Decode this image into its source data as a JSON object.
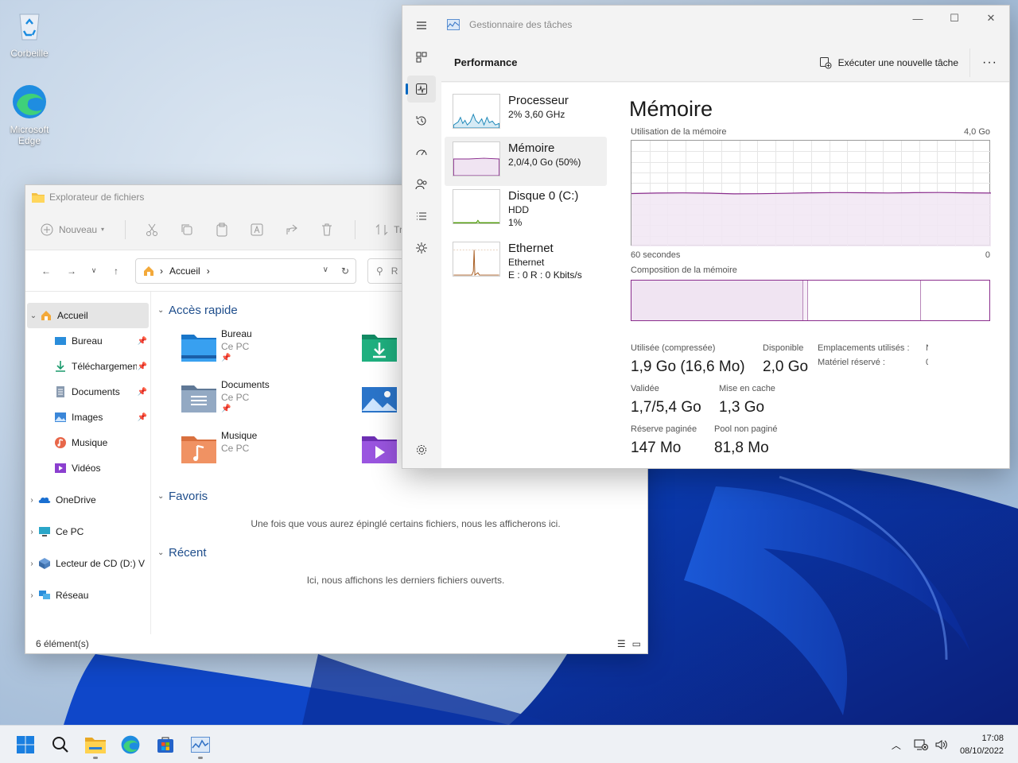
{
  "desktop": {
    "icons": [
      {
        "label": "Corbeille"
      },
      {
        "label": "Microsoft Edge"
      }
    ]
  },
  "explorer": {
    "title": "Explorateur de fichiers",
    "toolbar": {
      "new_label": "Nouveau",
      "sort_label": "Trier"
    },
    "address": {
      "crumb": "Accueil",
      "search_placeholder": "R"
    },
    "nav": {
      "home": "Accueil",
      "pinned": [
        "Bureau",
        "Téléchargements",
        "Documents",
        "Images",
        "Musique",
        "Vidéos"
      ],
      "onedrive": "OneDrive",
      "thispc": "Ce PC",
      "cd": "Lecteur de CD (D:) V",
      "network": "Réseau"
    },
    "quick_access": {
      "heading": "Accès rapide",
      "tiles": [
        {
          "name": "Bureau",
          "location": "Ce PC"
        },
        {
          "name": "Documents",
          "location": "Ce PC"
        },
        {
          "name": "Musique",
          "location": "Ce PC"
        }
      ]
    },
    "favorites": {
      "heading": "Favoris",
      "empty": "Une fois que vous aurez épinglé certains fichiers, nous les afficherons ici."
    },
    "recent": {
      "heading": "Récent",
      "empty": "Ici, nous affichons les derniers fichiers ouverts."
    },
    "status": "6 élément(s)"
  },
  "taskmgr": {
    "title": "Gestionnaire des tâches",
    "page": "Performance",
    "run_task": "Exécuter une nouvelle tâche",
    "resources": [
      {
        "name": "Processeur",
        "line1": "2%  3,60 GHz",
        "line2": ""
      },
      {
        "name": "Mémoire",
        "line1": "2,0/4,0 Go (50%)",
        "line2": ""
      },
      {
        "name": "Disque 0 (C:)",
        "line1": "HDD",
        "line2": "1%"
      },
      {
        "name": "Ethernet",
        "line1": "Ethernet",
        "line2": "E : 0 R : 0 Kbits/s"
      }
    ],
    "memory": {
      "title": "Mémoire",
      "usage_label": "Utilisation de la mémoire",
      "max_label": "4,0 Go",
      "time_label": "60 secondes",
      "zero_label": "0",
      "composition_label": "Composition de la mémoire",
      "usage_fraction": 0.5,
      "stats": {
        "in_use_label": "Utilisée (compressée)",
        "in_use": "1,9 Go (16,6 Mo)",
        "available_label": "Disponible",
        "available": "2,0 Go",
        "slots_label": "Emplacements utilisés :",
        "slots": "N",
        "reserved_label": "Matériel réservé :",
        "reserved": "0",
        "committed_label": "Validée",
        "committed": "1,7/5,4 Go",
        "cached_label": "Mise en cache",
        "cached": "1,3 Go",
        "paged_label": "Réserve paginée",
        "paged": "147 Mo",
        "nonpaged_label": "Pool non paginé",
        "nonpaged": "81,8 Mo"
      }
    }
  },
  "taskbar": {
    "time": "17:08",
    "date": "08/10/2022"
  }
}
